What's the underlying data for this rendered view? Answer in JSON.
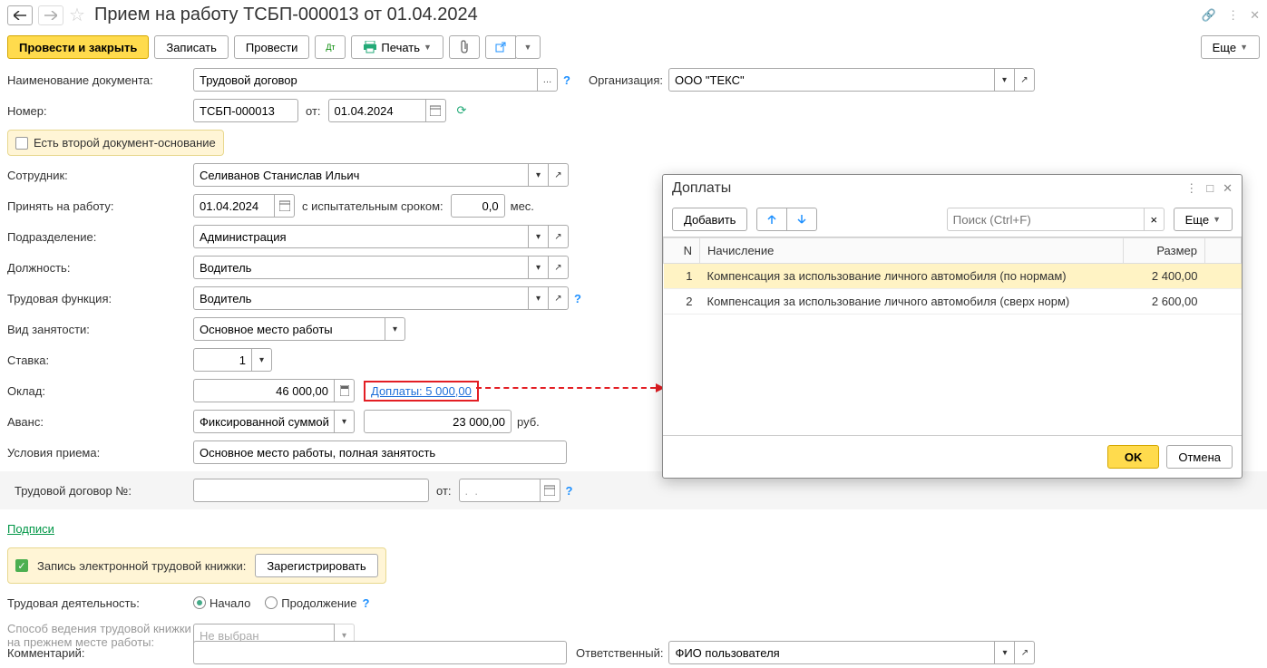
{
  "header": {
    "title": "Прием на работу ТСБП-000013 от 01.04.2024"
  },
  "toolbar": {
    "post_close": "Провести и закрыть",
    "write": "Записать",
    "post": "Провести",
    "print": "Печать",
    "more": "Еще"
  },
  "form": {
    "doc_name_label": "Наименование документа:",
    "doc_name_value": "Трудовой договор",
    "org_label": "Организация:",
    "org_value": "ООО \"ТЕКС\"",
    "number_label": "Номер:",
    "number_value": "ТСБП-000013",
    "from_label": "от:",
    "date_value": "01.04.2024",
    "second_doc_label": "Есть второй документ-основание",
    "employee_label": "Сотрудник:",
    "employee_value": "Селиванов Станислав Ильич",
    "hire_date_label": "Принять на работу:",
    "hire_date_value": "01.04.2024",
    "trial_label": "с испытательным сроком:",
    "trial_value": "0,0",
    "trial_unit": "мес.",
    "dept_label": "Подразделение:",
    "dept_value": "Администрация",
    "position_label": "Должность:",
    "position_value": "Водитель",
    "func_label": "Трудовая функция:",
    "func_value": "Водитель",
    "employ_type_label": "Вид занятости:",
    "employ_type_value": "Основное место работы",
    "rate_label": "Ставка:",
    "rate_value": "1",
    "salary_label": "Оклад:",
    "salary_value": "46 000,00",
    "addl_link": "Доплаты: 5 000,00",
    "advance_label": "Аванс:",
    "advance_type": "Фиксированной суммой",
    "advance_value": "23 000,00",
    "advance_unit": "руб.",
    "conditions_label": "Условия приема:",
    "conditions_value": "Основное место работы, полная занятость",
    "contract_no_label": "Трудовой договор №:",
    "contract_no_value": "",
    "contract_from": "от:",
    "contract_date": ".  .",
    "signatures": "Подписи",
    "ework_label": "Запись электронной трудовой книжки:",
    "register_btn": "Зарегистрировать",
    "activity_label": "Трудовая деятельность:",
    "activity_start": "Начало",
    "activity_cont": "Продолжение",
    "book_method_label": "Способ ведения трудовой книжки на прежнем месте работы:",
    "book_method_value": "Не выбран",
    "comment_label": "Комментарий:",
    "responsible_label": "Ответственный:",
    "responsible_value": "ФИО пользователя"
  },
  "popup": {
    "title": "Доплаты",
    "add": "Добавить",
    "search_ph": "Поиск (Ctrl+F)",
    "more": "Еще",
    "col_n": "N",
    "col_name": "Начисление",
    "col_size": "Размер",
    "rows": [
      {
        "n": "1",
        "name": "Компенсация за использование личного автомобиля (по нормам)",
        "size": "2 400,00"
      },
      {
        "n": "2",
        "name": "Компенсация за использование личного автомобиля (сверх норм)",
        "size": "2 600,00"
      }
    ],
    "ok": "OK",
    "cancel": "Отмена"
  }
}
